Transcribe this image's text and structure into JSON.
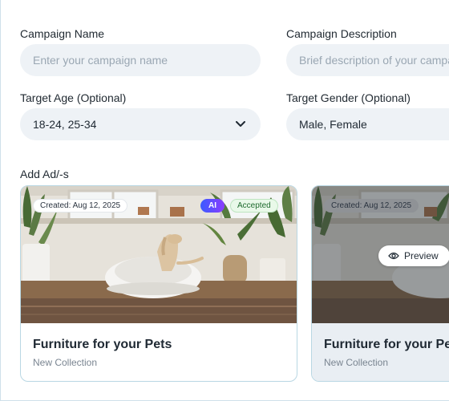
{
  "form": {
    "campaign_name": {
      "label": "Campaign Name",
      "placeholder": "Enter your campaign name",
      "value": ""
    },
    "campaign_description": {
      "label": "Campaign Description",
      "placeholder": "Brief description of your campaign",
      "value": ""
    },
    "target_age": {
      "label": "Target Age (Optional)",
      "value": "18-24, 25-34"
    },
    "target_gender": {
      "label": "Target Gender (Optional)",
      "value": "Male, Female"
    }
  },
  "ads": {
    "label": "Add Ad/-s",
    "cards": [
      {
        "created": "Created: Aug 12, 2025",
        "ai_badge": "AI",
        "status": "Accepted",
        "title": "Furniture for your Pets",
        "subtitle": "New Collection"
      },
      {
        "created": "Created: Aug 12, 2025",
        "preview_label": "Preview",
        "title": "Furniture for your Pets",
        "subtitle": "New Collection"
      }
    ]
  },
  "colors": {
    "field_bg": "#eef2f6",
    "card_border": "#b9d7e3",
    "accepted_bg": "#e9f9e9",
    "ai_gradient_start": "#3b5bff",
    "ai_gradient_end": "#8b3dff"
  },
  "icons": [
    "chevron-down-icon",
    "eye-icon"
  ]
}
